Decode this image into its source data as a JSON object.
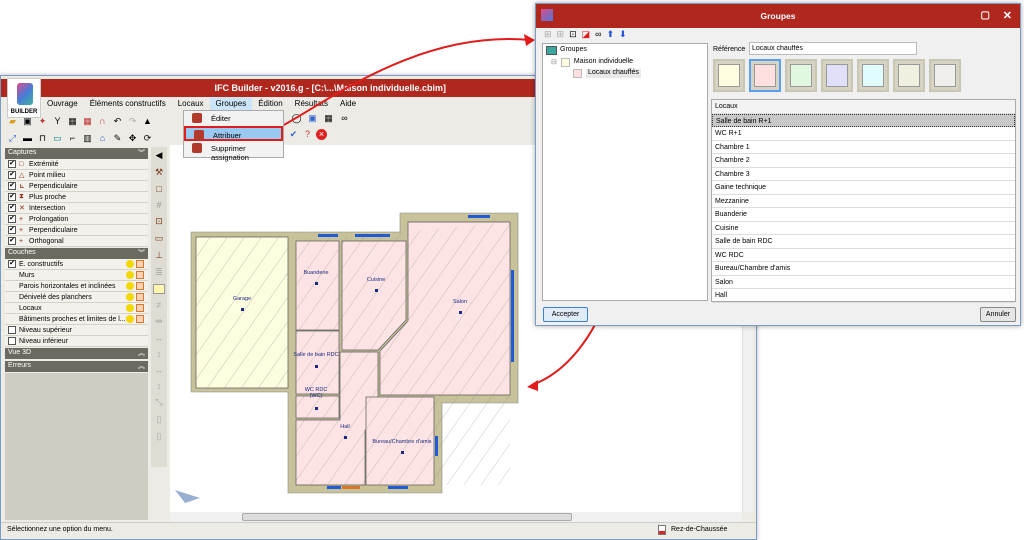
{
  "main_window": {
    "title": "IFC Builder - v2016.g - [C:\\...\\Maison individuelle.cbim]",
    "logo_text": "BUILDER",
    "menu": [
      "Ouvrage",
      "Éléments constructifs",
      "Locaux",
      "Groupes",
      "Édition",
      "Résultats",
      "Aide"
    ],
    "groupes_menu": [
      "Éditer",
      "Attribuer",
      "Supprimer assignation"
    ],
    "captures": {
      "title": "Captures",
      "items": [
        "Extrémité",
        "Point milieu",
        "Perpendiculaire",
        "Plus proche",
        "Intersection",
        "Prolongation",
        "Perpendiculaire",
        "Orthogonal"
      ]
    },
    "couches": {
      "title": "Couches",
      "items": [
        "E. constructifs",
        "Murs",
        "Parois horizontales et inclinées",
        "Dénivelé des planchers",
        "Locaux",
        "Bâtiments proches et limites de l...",
        "Niveau supérieur",
        "Niveau inférieur"
      ]
    },
    "vue3d": "Vue 3D",
    "erreurs": "Erreurs",
    "status_text": "Sélectionnez une option du menu.",
    "level": "Rez-de-Chaussée",
    "rooms": [
      "Garage",
      "Buanderie",
      "Cuisine",
      "Salon",
      "Salle de bain RDC",
      "WC RDC",
      "(WC)",
      "Hall",
      "Bureau/Chambre d'amis"
    ]
  },
  "dialog": {
    "title": "Groupes",
    "tree": [
      "Groupes",
      "Maison individuelle",
      "Locaux chauffés"
    ],
    "reference_label": "Référence",
    "reference_value": "Locaux chauffés",
    "swatches": [
      "#fffde0",
      "#ffe0e0",
      "#e0f8e0",
      "#e0e0fb",
      "#e0fcfc",
      "#f1f0e0",
      "#f0efec"
    ],
    "list_header": "Locaux",
    "locaux": [
      "Salle de bain R+1",
      "WC R+1",
      "Chambre 1",
      "Chambre 2",
      "Chambre 3",
      "Gaine technique",
      "Mezzanine",
      "Buanderie",
      "Cuisine",
      "Salle de bain RDC",
      "WC RDC",
      "Bureau/Chambre d'amis",
      "Salon",
      "Hall"
    ],
    "accept": "Accepter",
    "cancel": "Annuler"
  },
  "colors": {
    "title_bar": "#b0271e",
    "wall": "#c8c29a",
    "heated": "#fde3e3",
    "garage": "#fdfde0",
    "arrow": "#e21b1b"
  }
}
